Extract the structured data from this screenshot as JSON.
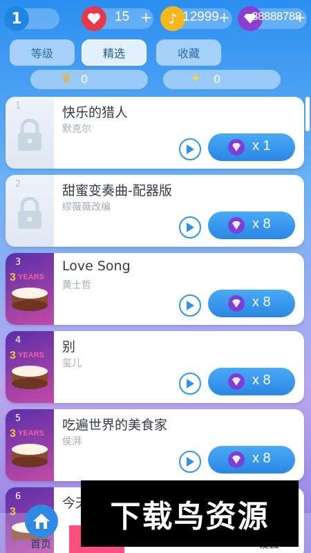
{
  "header": {
    "level": "1",
    "lives": "15",
    "coins": "12999",
    "gems": "88888788",
    "plus": "+"
  },
  "tabs": [
    "等级",
    "精选",
    "收藏"
  ],
  "subcounts": {
    "crown": "0",
    "spark": "0"
  },
  "songs": [
    {
      "num": "1",
      "title": "快乐的猎人",
      "artist": "默克尔",
      "cost": "x 1"
    },
    {
      "num": "2",
      "title": "甜蜜变奏曲-配器版",
      "artist": "缪薇薇改编",
      "cost": "x 8"
    },
    {
      "num": "3",
      "title": "Love Song",
      "artist": "黄士哲",
      "cost": "x 8"
    },
    {
      "num": "4",
      "title": "别",
      "artist": "玺儿",
      "cost": "x 8"
    },
    {
      "num": "5",
      "title": "吃遍世界的美食家",
      "artist": "侯湃",
      "cost": "x 8"
    },
    {
      "num": "6",
      "title": "今天",
      "artist": "",
      "cost": ""
    }
  ],
  "nav": {
    "home": "首页",
    "settings": "设置"
  },
  "watermark": "下载鸟资源",
  "colors": {
    "accent": "#2f93e8",
    "gem": "#8a3fd1",
    "heart": "#e8384b",
    "coin": "#f4b71e"
  }
}
